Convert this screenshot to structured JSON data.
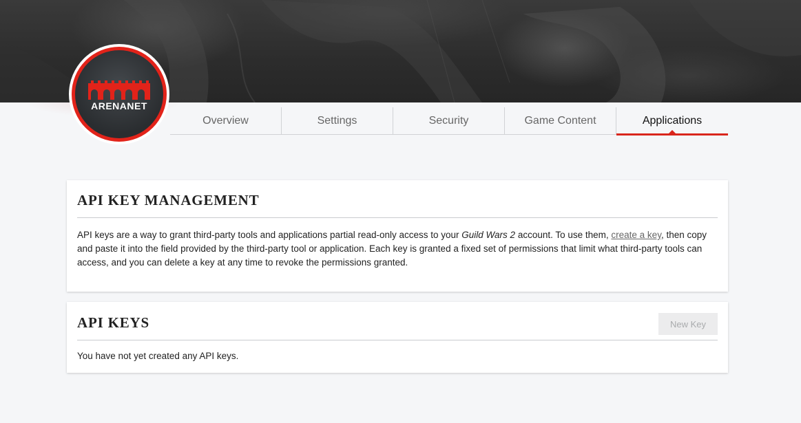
{
  "logo": {
    "text": "ARENANET"
  },
  "tabs": [
    {
      "label": "Overview",
      "active": false
    },
    {
      "label": "Settings",
      "active": false
    },
    {
      "label": "Security",
      "active": false
    },
    {
      "label": "Game Content",
      "active": false
    },
    {
      "label": "Applications",
      "active": true
    }
  ],
  "api_management": {
    "title": "API KEY MANAGEMENT",
    "desc_part1": "API keys are a way to grant third-party tools and applications partial read-only access to your ",
    "desc_game": "Guild Wars 2",
    "desc_part2": " account. To use them, ",
    "desc_link": "create a key",
    "desc_part3": ", then copy and paste it into the field provided by the third-party tool or application. Each key is granted a fixed set of permissions that limit what third-party tools can access, and you can delete a key at any time to revoke the permissions granted."
  },
  "api_keys": {
    "title": "API KEYS",
    "new_key_label": "New Key",
    "empty_message": "You have not yet created any API keys."
  },
  "colors": {
    "accent": "#d9261c",
    "logo_red": "#e2231a",
    "background": "#f5f6f8"
  }
}
